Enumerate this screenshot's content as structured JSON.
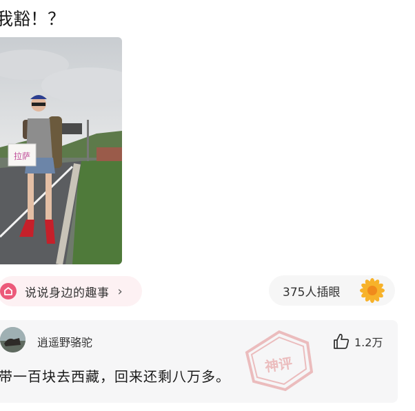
{
  "post": {
    "title": "我豁！？"
  },
  "photo": {
    "sign_text": "拉萨"
  },
  "topic": {
    "label": "说说身边的趣事",
    "chevron": "›",
    "icon": "home-icon"
  },
  "views": {
    "label": "375人插眼",
    "icon": "sunflower-icon"
  },
  "comment": {
    "username": "逍遥野骆驼",
    "like_count": "1.2万",
    "text": "带一百块去西藏，回来还剩八万多。",
    "stamp_text": "神评"
  },
  "colors": {
    "topic_pink": "#ec5a7a",
    "topic_bg": "#fdf1f3",
    "card_bg": "#f6f6f7",
    "stamp_red": "#d02b2b"
  }
}
